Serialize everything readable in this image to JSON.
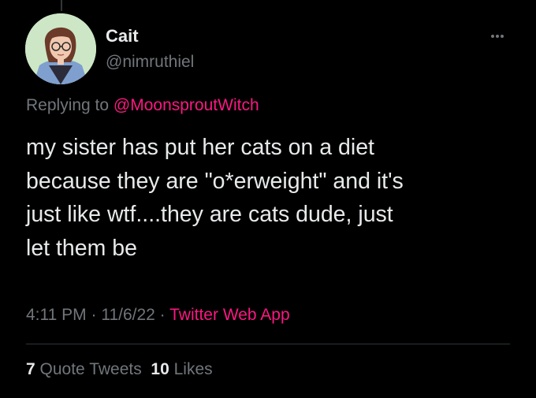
{
  "user": {
    "display_name": "Cait",
    "handle": "@nimruthiel",
    "avatar_icon": "illustrated-person-with-glasses"
  },
  "reply": {
    "prefix": "Replying to",
    "mention": "@MoonsproutWitch"
  },
  "tweet": {
    "lines": [
      "my sister has put her cats on a diet",
      "because they are \"o*erweight\" and it's",
      "just like wtf....they are cats dude, just",
      "let them be"
    ]
  },
  "meta": {
    "time": "4:11 PM",
    "sep1": " · ",
    "date": "11/6/22",
    "sep2": " · ",
    "source": "Twitter Web App"
  },
  "stats": {
    "quote_count": "7",
    "quote_label": "Quote Tweets",
    "like_count": "10",
    "like_label": "Likes"
  },
  "colors": {
    "background": "#000000",
    "text": "#e7e9ea",
    "secondary": "#71767b",
    "accent": "#f91880"
  }
}
